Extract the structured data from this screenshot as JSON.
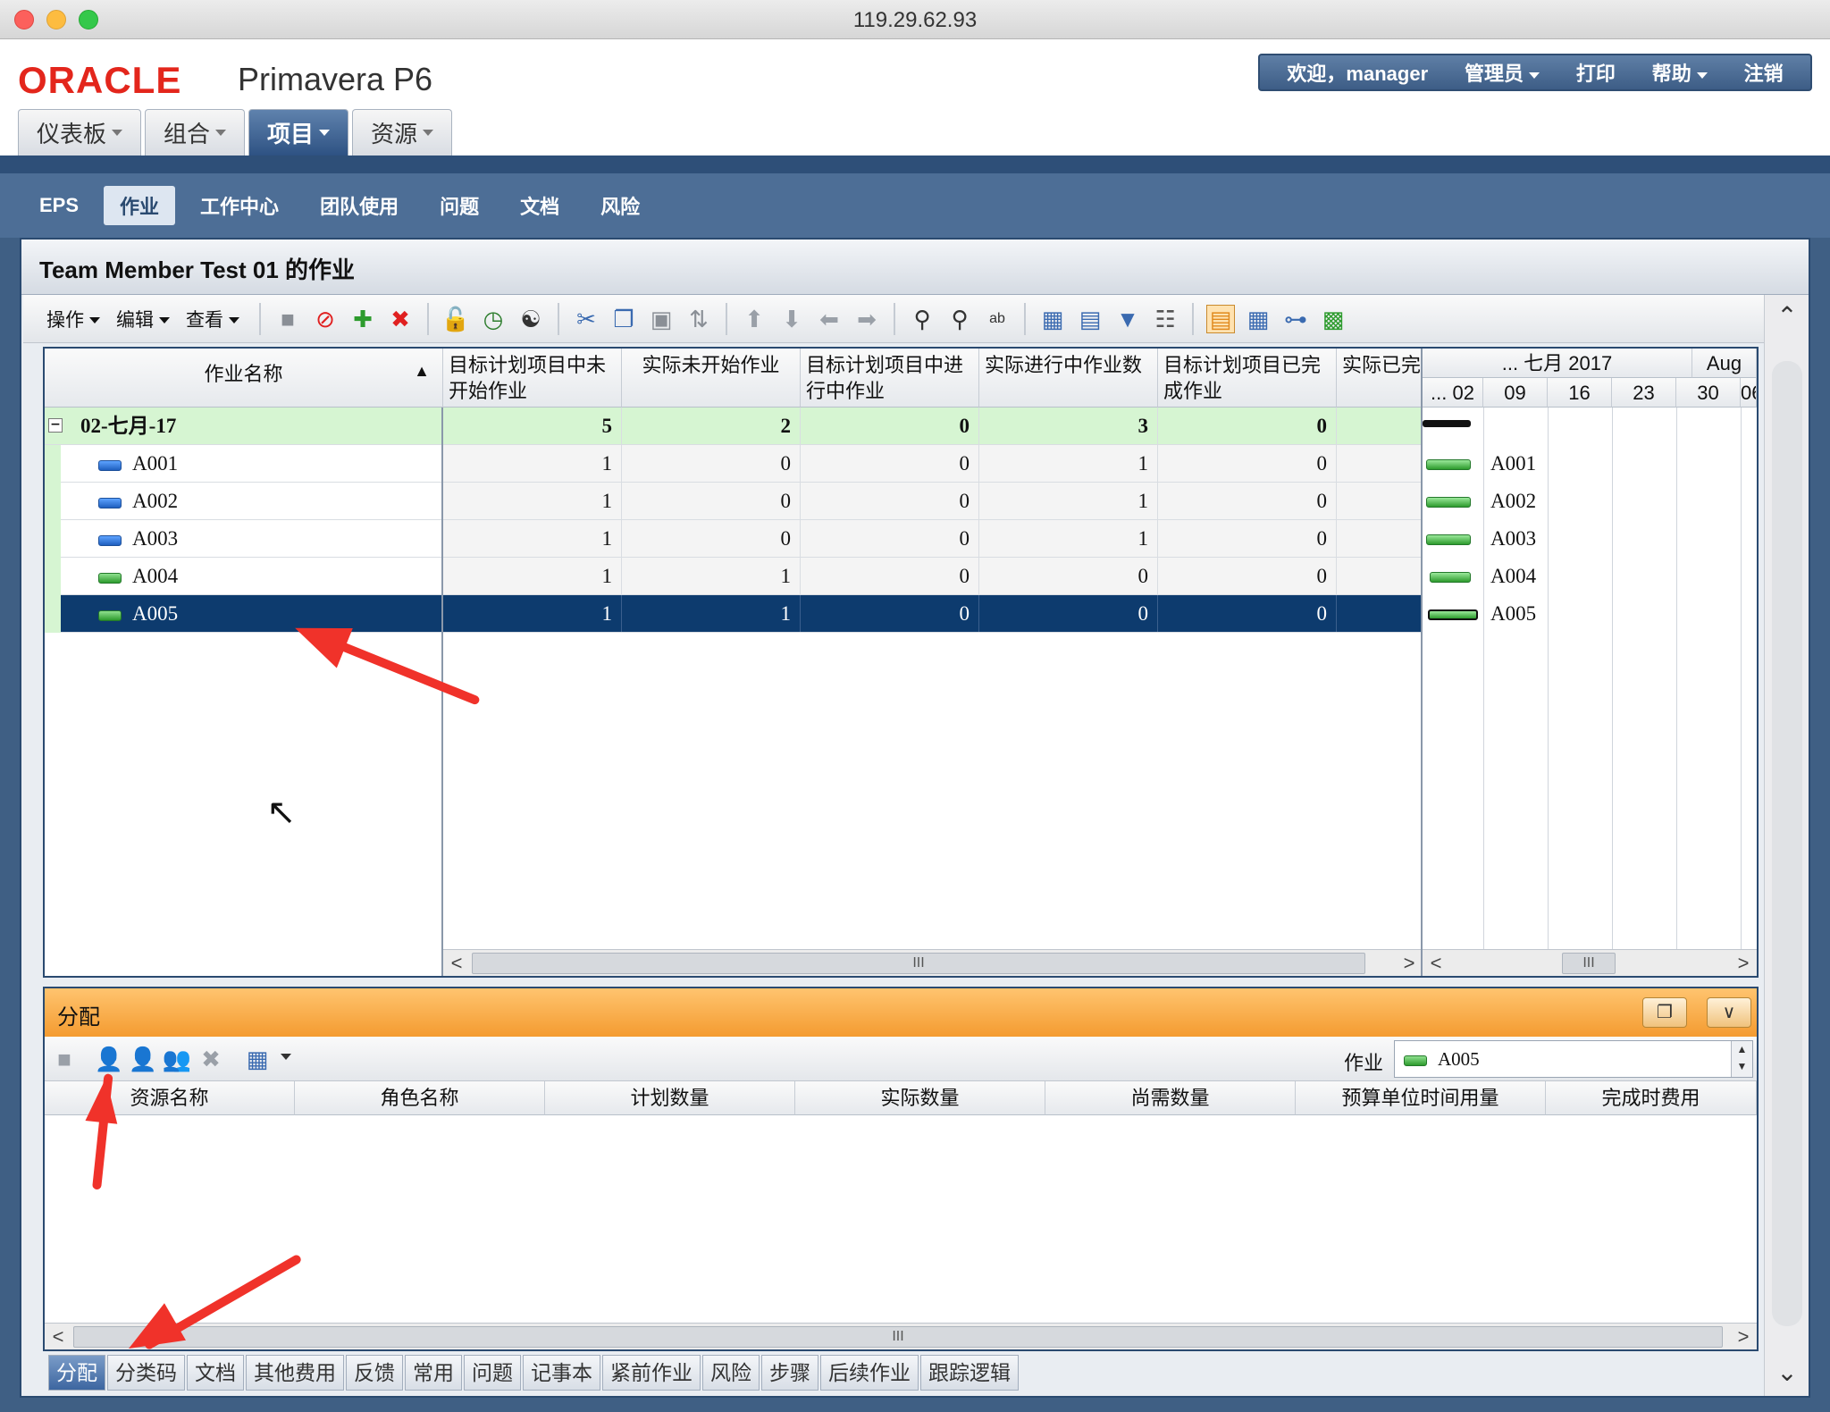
{
  "window": {
    "title": "119.29.62.93"
  },
  "brand": {
    "oracle": "ORACLE",
    "product": "Primavera P6",
    "oracle_color": "#e3261c"
  },
  "topmenu": {
    "welcome": "欢迎，manager",
    "admin": "管理员",
    "print": "打印",
    "help": "帮助",
    "logout": "注销"
  },
  "maintabs": [
    {
      "label": "仪表板"
    },
    {
      "label": "组合"
    },
    {
      "label": "项目"
    },
    {
      "label": "资源"
    }
  ],
  "subnav": [
    "EPS",
    "作业",
    "工作中心",
    "团队使用",
    "问题",
    "文档",
    "风险"
  ],
  "panel": {
    "title": "Team Member Test 01 的作业"
  },
  "toolbar": {
    "actions": "操作",
    "edit": "编辑",
    "view": "查看"
  },
  "grid": {
    "columns": {
      "name": "作业名称",
      "c1": "目标计划项目中未开始作业",
      "c2": "实际未开始作业",
      "c3": "目标计划项目中进行中作业",
      "c4": "实际进行中作业数",
      "c5": "目标计划项目已完成作业",
      "c6": "实际已完"
    },
    "group": {
      "label": "02-七月-17",
      "v1": "5",
      "v2": "2",
      "v3": "0",
      "v4": "3",
      "v5": "0"
    },
    "rows": [
      {
        "name": "A001",
        "v1": "1",
        "v2": "0",
        "v3": "0",
        "v4": "1",
        "v5": "0",
        "color": "blue"
      },
      {
        "name": "A002",
        "v1": "1",
        "v2": "0",
        "v3": "0",
        "v4": "1",
        "v5": "0",
        "color": "blue"
      },
      {
        "name": "A003",
        "v1": "1",
        "v2": "0",
        "v3": "0",
        "v4": "1",
        "v5": "0",
        "color": "blue"
      },
      {
        "name": "A004",
        "v1": "1",
        "v2": "1",
        "v3": "0",
        "v4": "0",
        "v5": "0",
        "color": "green"
      },
      {
        "name": "A005",
        "v1": "1",
        "v2": "1",
        "v3": "0",
        "v4": "0",
        "v5": "0",
        "color": "green"
      }
    ]
  },
  "gantt": {
    "month1": "... 七月 2017",
    "month2": "Aug",
    "weeks": [
      "... 02",
      "09",
      "16",
      "23",
      "30",
      "06"
    ]
  },
  "assign": {
    "title": "分配",
    "activity_label": "作业",
    "activity_value": "A005",
    "columns": [
      "资源名称",
      "角色名称",
      "计划数量",
      "实际数量",
      "尚需数量",
      "预算单位时间用量",
      "完成时费用"
    ]
  },
  "bottom_tabs": [
    "分配",
    "分类码",
    "文档",
    "其他费用",
    "反馈",
    "常用",
    "问题",
    "记事本",
    "紧前作业",
    "风险",
    "步骤",
    "后续作业",
    "跟踪逻辑"
  ],
  "scroll": {
    "thumb_label": "III"
  }
}
